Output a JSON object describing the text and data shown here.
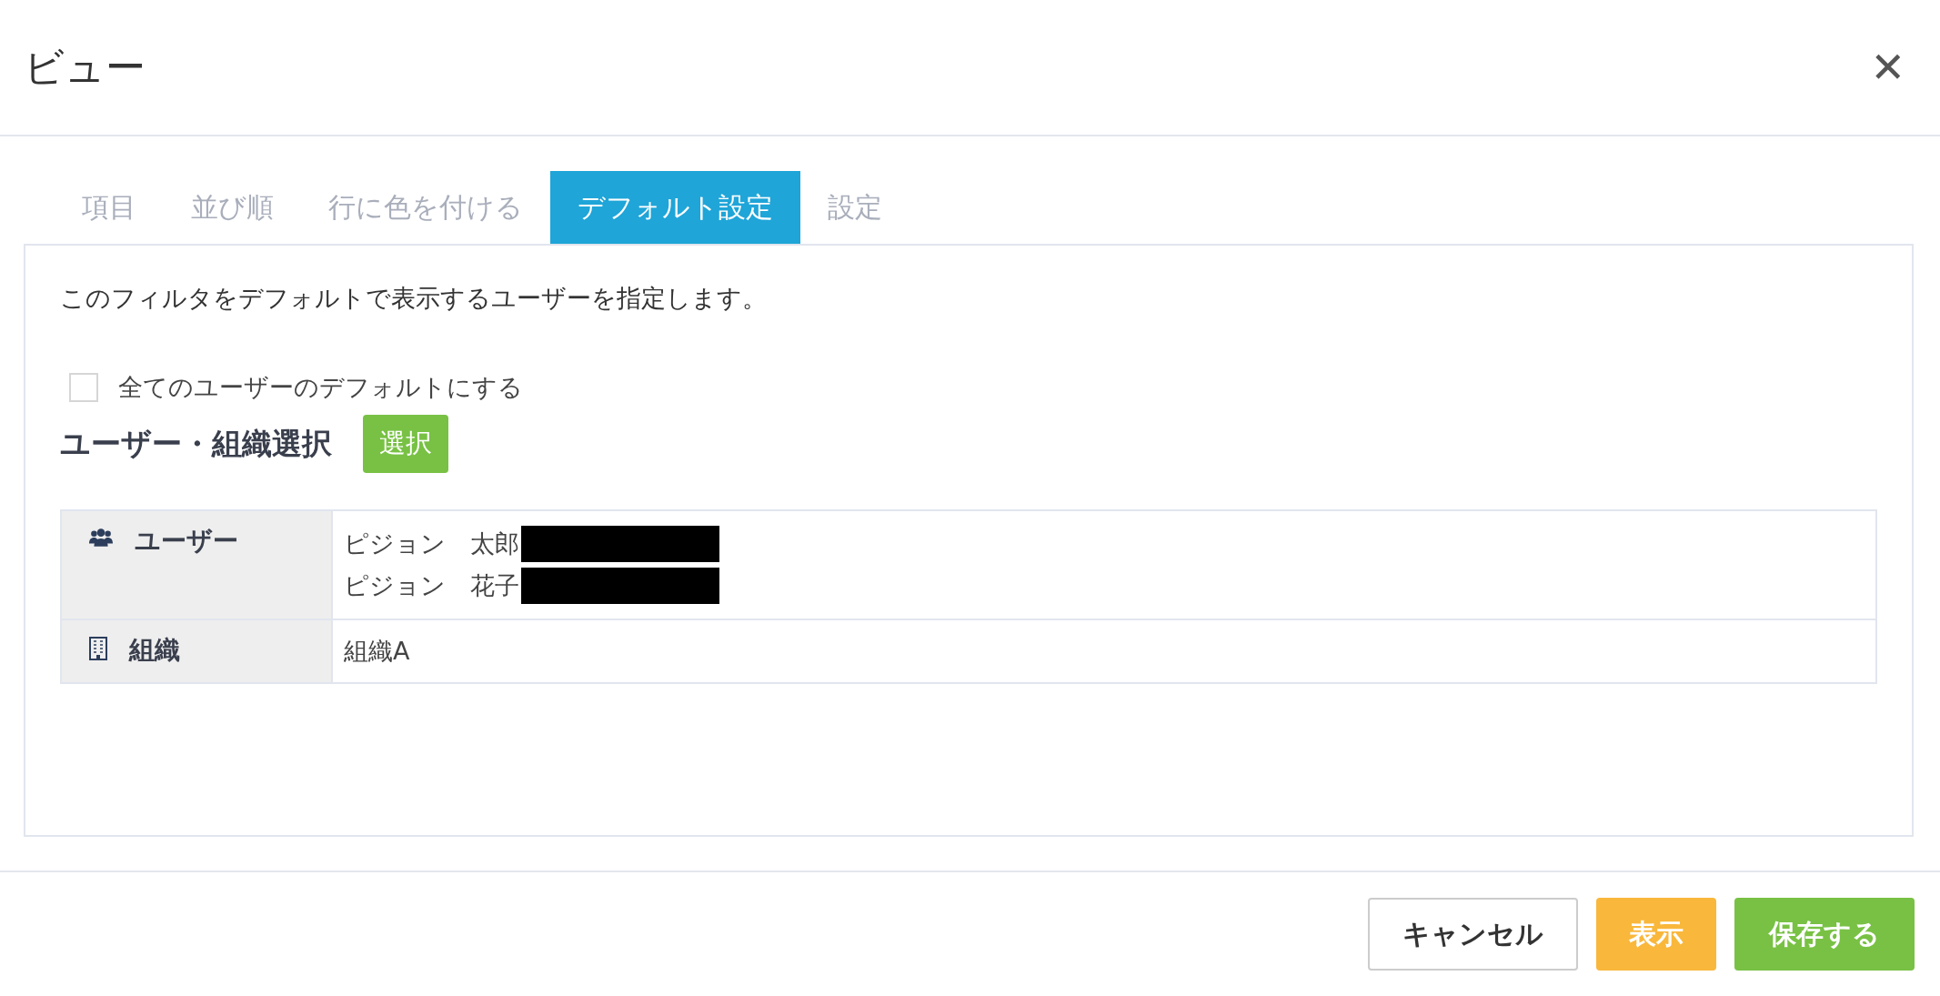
{
  "window": {
    "title": "ビュー",
    "close": "✕"
  },
  "tabs": [
    {
      "label": "項目",
      "selected": false
    },
    {
      "label": "並び順",
      "selected": false
    },
    {
      "label": "行に色を付ける",
      "selected": false
    },
    {
      "label": "デフォルト設定",
      "selected": true
    },
    {
      "label": "設定",
      "selected": false
    }
  ],
  "description": "このフィルタをデフォルトで表示するユーザーを指定します。",
  "all_users_checkbox": {
    "label": "全てのユーザーのデフォルトにする",
    "checked": false
  },
  "selection": {
    "heading": "ユーザー・組織選択",
    "button": "選択"
  },
  "table": {
    "rows": [
      {
        "kind": "users",
        "label": "ユーザー",
        "values": [
          {
            "text": "ピジョン　太郎",
            "redacted": true
          },
          {
            "text": "ピジョン　花子",
            "redacted": true
          }
        ]
      },
      {
        "kind": "organizations",
        "label": "組織",
        "values": [
          {
            "text": "組織A",
            "redacted": false
          }
        ]
      }
    ]
  },
  "buttons": [
    {
      "label": "キャンセル",
      "kind": "cancel"
    },
    {
      "label": "表示",
      "kind": "preview"
    },
    {
      "label": "保存する",
      "kind": "save"
    }
  ]
}
